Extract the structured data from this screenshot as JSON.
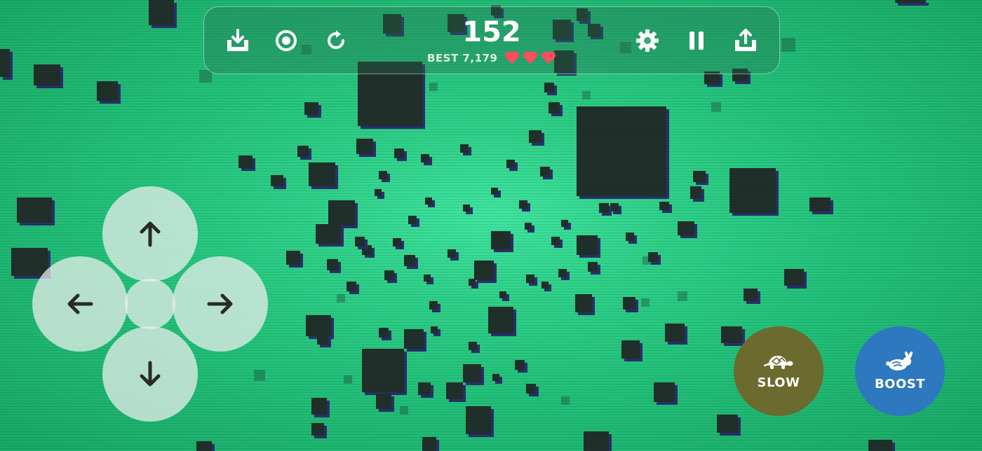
{
  "hud": {
    "score": "152",
    "best": "BEST 7,179",
    "lives": 3,
    "heart_color": "#ff4d5e",
    "buttons": [
      "import-icon",
      "target-icon",
      "restart-icon",
      "gear-icon",
      "pause-icon",
      "share-icon"
    ]
  },
  "controls": {
    "slow_label": "SLOW",
    "boost_label": "BOOST",
    "slow_color": "#6b6a2f",
    "boost_color": "#2d78be"
  },
  "colors": {
    "background": "#2fd189",
    "cube": "#20302a",
    "cube_side": "#2a2f6e"
  }
}
